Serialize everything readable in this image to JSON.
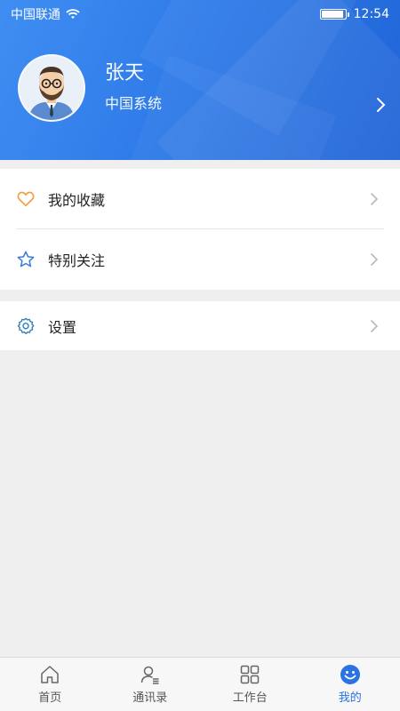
{
  "status_bar": {
    "carrier": "中国联通",
    "time": "12:54"
  },
  "profile": {
    "name": "张天",
    "organization": "中国系统"
  },
  "menu": {
    "favorites_label": "我的收藏",
    "follow_label": "特别关注",
    "settings_label": "设置"
  },
  "tabs": [
    {
      "label": "首页",
      "icon": "home-icon"
    },
    {
      "label": "通讯录",
      "icon": "contacts-icon"
    },
    {
      "label": "工作台",
      "icon": "grid-icon"
    },
    {
      "label": "我的",
      "icon": "smiley-icon",
      "active": true
    }
  ],
  "colors": {
    "header_blue": "#2f7be9",
    "accent": "#2b73e3",
    "heart_orange": "#f0a040",
    "star_blue": "#3d7fd6",
    "gear_blue": "#2f7fb8"
  }
}
